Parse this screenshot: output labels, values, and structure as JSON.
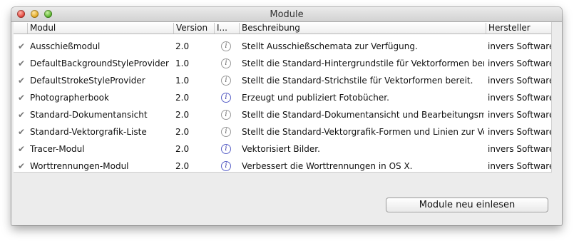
{
  "window": {
    "title": "Module"
  },
  "table": {
    "headers": {
      "modul": "Modul",
      "version": "Version",
      "info": "I...",
      "beschreibung": "Beschreibung",
      "hersteller": "Hersteller"
    },
    "rows": [
      {
        "checked": true,
        "name": "Ausschießmodul",
        "version": "2.0",
        "info_active": false,
        "description": "Stellt Ausschießschemata zur Verfügung.",
        "vendor": "invers Software"
      },
      {
        "checked": true,
        "name": "DefaultBackgroundStyleProvider",
        "version": "1.0",
        "info_active": false,
        "description": "Stellt die Standard-Hintergrundstile für Vektorformen bere",
        "vendor": "invers Software"
      },
      {
        "checked": true,
        "name": "DefaultStrokeStyleProvider",
        "version": "1.0",
        "info_active": false,
        "description": "Stellt die Standard-Strichstile für Vektorformen bereit.",
        "vendor": "invers Software"
      },
      {
        "checked": true,
        "name": "Photographerbook",
        "version": "2.0",
        "info_active": true,
        "description": "Erzeugt und publiziert Fotobücher.",
        "vendor": "invers Software"
      },
      {
        "checked": true,
        "name": "Standard-Dokumentansicht",
        "version": "2.0",
        "info_active": false,
        "description": "Stellt die Standard-Dokumentansicht und Bearbeitungsmö",
        "vendor": "invers Software"
      },
      {
        "checked": true,
        "name": "Standard-Vektorgrafik-Liste",
        "version": "2.0",
        "info_active": false,
        "description": "Stellt die Standard-Vektorgrafik-Formen und Linien zur Ve",
        "vendor": "invers Software"
      },
      {
        "checked": true,
        "name": "Tracer-Modul",
        "version": "2.0",
        "info_active": true,
        "description": "Vektorisiert Bilder.",
        "vendor": "invers Software"
      },
      {
        "checked": true,
        "name": "Worttrennungen-Modul",
        "version": "2.0",
        "info_active": true,
        "description": "Verbessert die Worttrennungen in OS X.",
        "vendor": "invers Software"
      }
    ]
  },
  "footer": {
    "reload_button": "Module neu einlesen"
  },
  "icons": {
    "check": "checkmark-icon",
    "info": "info-icon"
  }
}
